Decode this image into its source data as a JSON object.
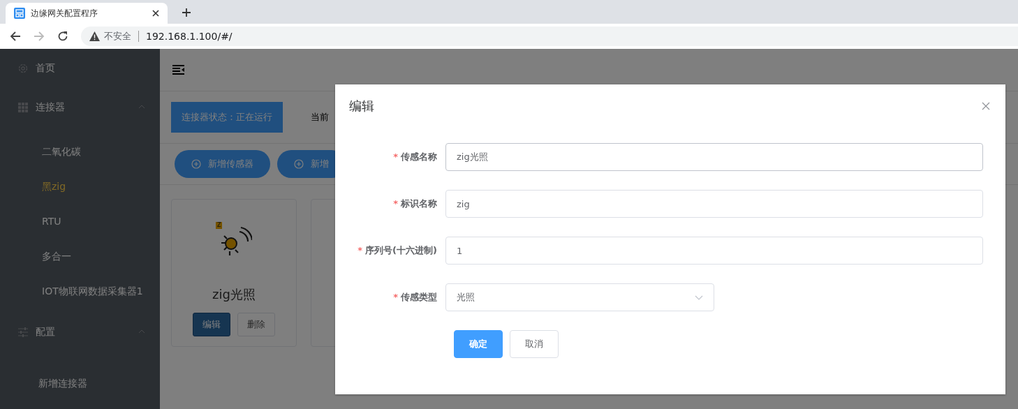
{
  "browser": {
    "tab": {
      "title": "边缘网关配置程序"
    },
    "forward": {
      "disabled": true
    },
    "address": {
      "security": "不安全",
      "url": "192.168.1.100/#/"
    }
  },
  "sidebar": {
    "items": [
      {
        "label": "首页"
      },
      {
        "label": "连接器",
        "expanded": true,
        "children": [
          {
            "label": "二氧化碳",
            "selected": false
          },
          {
            "label": "黑zig",
            "selected": true
          },
          {
            "label": "RTU",
            "selected": false
          },
          {
            "label": "多合一",
            "selected": false
          },
          {
            "label": "IOT物联网数据采集器1",
            "selected": false
          }
        ]
      },
      {
        "label": "配置",
        "expanded": true,
        "children": [
          {
            "label": "新增连接器",
            "selected": false
          }
        ]
      }
    ]
  },
  "status": {
    "label": "连接器状态：正在运行",
    "current": "当前"
  },
  "actions": [
    "新增传感器",
    "新增"
  ],
  "cards": [
    {
      "badge": "Z",
      "title": "zig光照",
      "edit": "编辑",
      "delete": "删除"
    }
  ],
  "dialog": {
    "title": "编辑",
    "required_mark": "*",
    "fields": [
      {
        "label": "传感名称",
        "required": true,
        "kind": "input",
        "value": "zig光照",
        "focused": true
      },
      {
        "label": "标识名称",
        "required": true,
        "kind": "input",
        "value": "zig",
        "focused": false
      },
      {
        "label": "序列号(十六进制)",
        "required": true,
        "kind": "input",
        "value": "1",
        "focused": false
      },
      {
        "label": "传感类型",
        "required": true,
        "kind": "select",
        "value": "光照",
        "focused": false
      }
    ],
    "buttons": [
      {
        "label": "确定",
        "primary": true
      },
      {
        "label": "取消",
        "primary": false
      }
    ]
  }
}
